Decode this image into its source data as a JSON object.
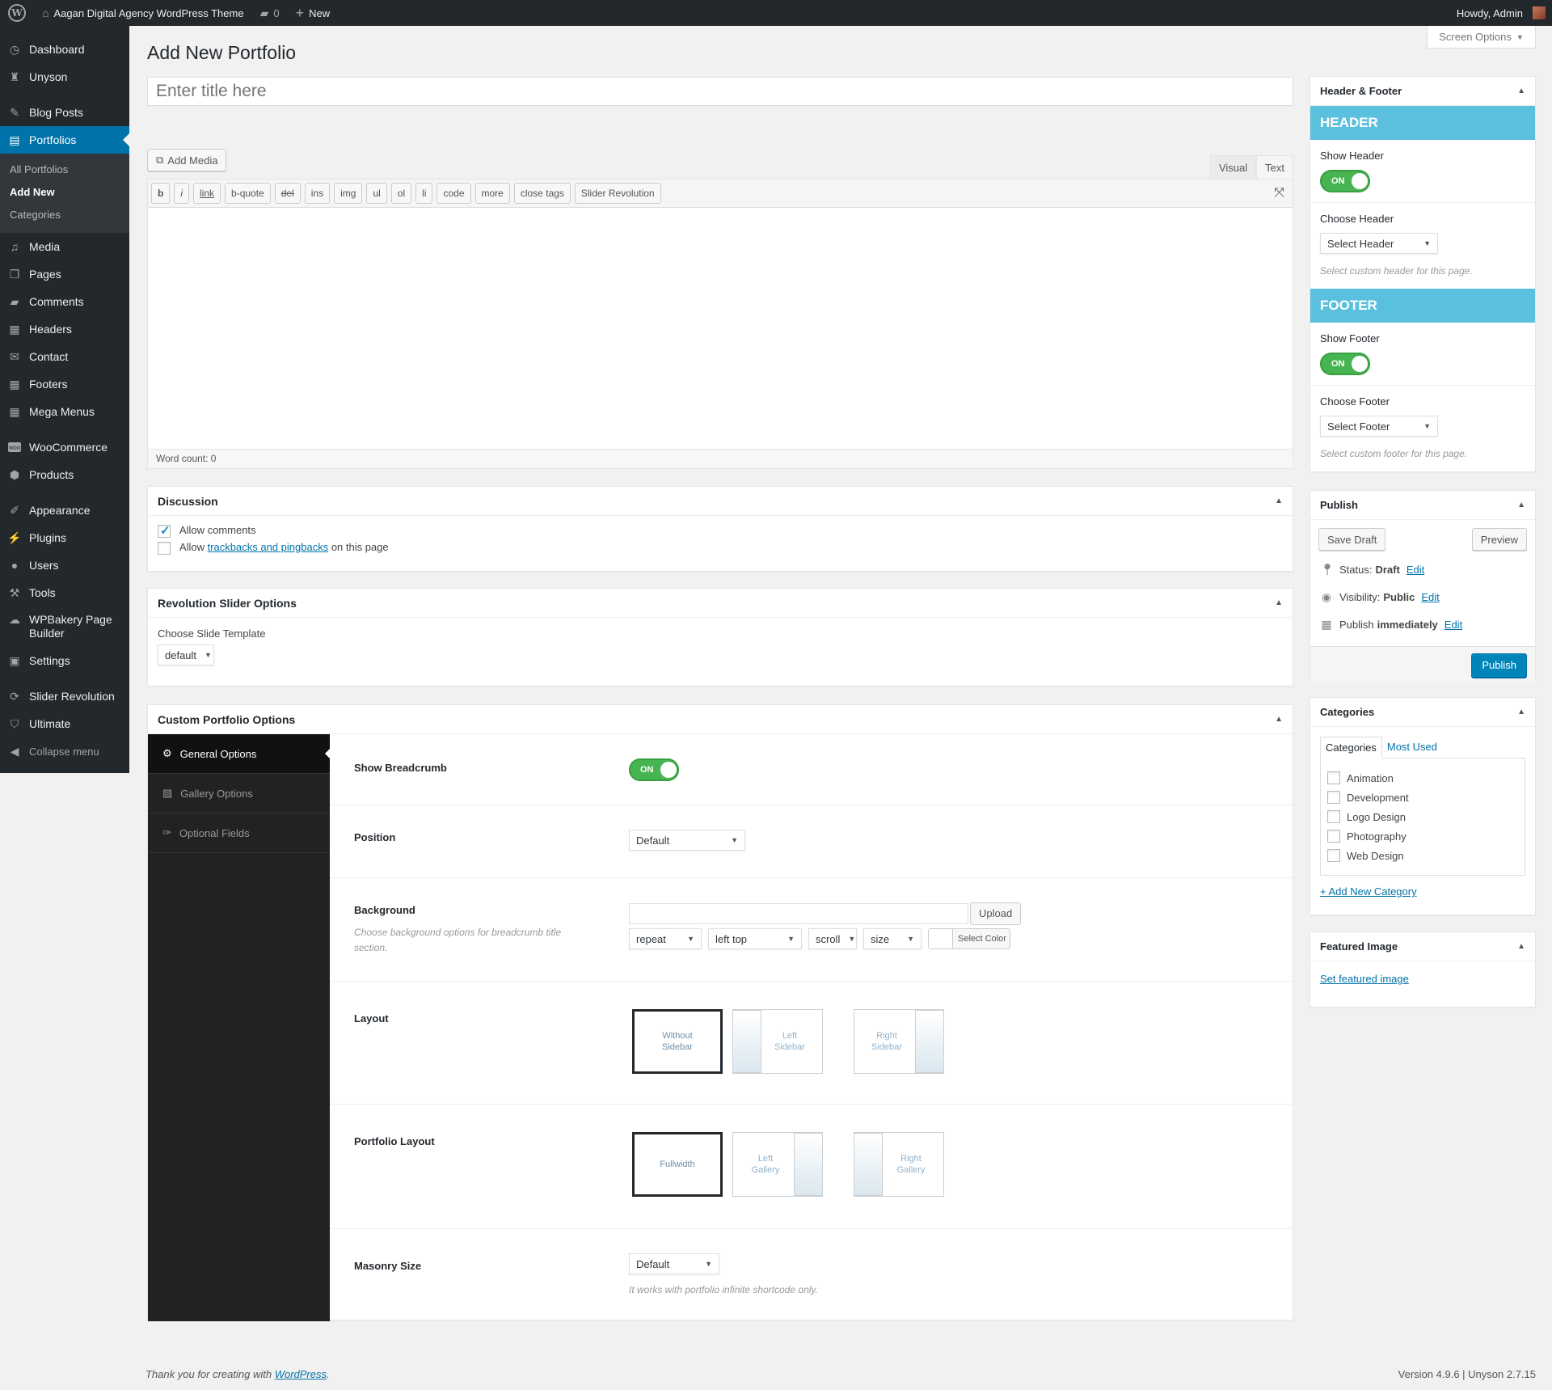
{
  "adminbar": {
    "site_name": "Aagan Digital Agency WordPress Theme",
    "comments_count": "0",
    "new_label": "New",
    "howdy": "Howdy, Admin"
  },
  "sidebar": {
    "dashboard": "Dashboard",
    "unyson": "Unyson",
    "blog_posts": "Blog Posts",
    "portfolios": "Portfolios",
    "sub_all": "All Portfolios",
    "sub_add": "Add New",
    "sub_categories": "Categories",
    "media": "Media",
    "pages": "Pages",
    "comments": "Comments",
    "headers": "Headers",
    "contact": "Contact",
    "footers": "Footers",
    "mega_menus": "Mega Menus",
    "woocommerce": "WooCommerce",
    "products": "Products",
    "appearance": "Appearance",
    "plugins": "Plugins",
    "users": "Users",
    "tools": "Tools",
    "wpbakery_1": "WPBakery Page",
    "wpbakery_2": "Builder",
    "settings": "Settings",
    "slider_revolution": "Slider Revolution",
    "ultimate": "Ultimate",
    "collapse": "Collapse menu"
  },
  "screen_options": "Screen Options",
  "page_title": "Add New Portfolio",
  "title_placeholder": "Enter title here",
  "editor": {
    "add_media": "Add Media",
    "tab_visual": "Visual",
    "tab_text": "Text",
    "qt": [
      "b",
      "i",
      "link",
      "b-quote",
      "del",
      "ins",
      "img",
      "ul",
      "ol",
      "li",
      "code",
      "more",
      "close tags",
      "Slider Revolution"
    ],
    "word_count": "Word count: 0"
  },
  "discussion": {
    "title": "Discussion",
    "allow_comments": "Allow comments",
    "allow_prefix": "Allow",
    "trackbacks_link": "trackbacks and pingbacks",
    "allow_suffix": "on this page"
  },
  "rev_slider": {
    "title": "Revolution Slider Options",
    "choose_label": "Choose Slide Template",
    "template_value": "default"
  },
  "custom_portfolio": {
    "title": "Custom Portfolio Options",
    "nav": [
      "General Options",
      "Gallery Options",
      "Optional Fields"
    ],
    "show_breadcrumb": "Show Breadcrumb",
    "switch_on": "ON",
    "position_label": "Position",
    "position_value": "Default",
    "background_label": "Background",
    "background_desc": "Choose background options for breadcrumb title section.",
    "upload": "Upload",
    "bg_repeat": "repeat",
    "bg_position": "left top",
    "bg_attachment": "scroll",
    "bg_size": "size",
    "select_color": "Select Color",
    "layout_label": "Layout",
    "layout_opts": [
      "Without Sidebar",
      "Left Sidebar",
      "Right Sidebar"
    ],
    "portfolio_layout_label": "Portfolio Layout",
    "portfolio_layout_opts": [
      "Fullwidth",
      "Left Gallery",
      "Right Gallery"
    ],
    "masonry_label": "Masonry Size",
    "masonry_value": "Default",
    "masonry_desc": "It works with portfolio infinite shortcode only."
  },
  "header_footer": {
    "title": "Header & Footer",
    "header_banner": "HEADER",
    "show_header": "Show Header",
    "choose_header": "Choose Header",
    "select_header": "Select Header",
    "header_desc": "Select custom header for this page.",
    "footer_banner": "FOOTER",
    "show_footer": "Show Footer",
    "choose_footer": "Choose Footer",
    "select_footer": "Select Footer",
    "footer_desc": "Select custom footer for this page."
  },
  "publish": {
    "title": "Publish",
    "save_draft": "Save Draft",
    "preview": "Preview",
    "status_label": "Status:",
    "status_value": "Draft",
    "visibility_label": "Visibility:",
    "visibility_value": "Public",
    "publish_label": "Publish",
    "publish_value": "immediately",
    "edit": "Edit",
    "publish_btn": "Publish"
  },
  "categories": {
    "title": "Categories",
    "tab_all": "Categories",
    "tab_most": "Most Used",
    "items": [
      "Animation",
      "Development",
      "Logo Design",
      "Photography",
      "Web Design"
    ],
    "add_new": "+ Add New Category"
  },
  "featured": {
    "title": "Featured Image",
    "set_link": "Set featured image"
  },
  "footer": {
    "thanks_prefix": "Thank you for creating with",
    "wordpress": "WordPress",
    "thanks_suffix": ".",
    "version": "Version 4.9.6 | Unyson 2.7.15"
  },
  "colors": {
    "accent": "#0073aa",
    "banner": "#5bc0de",
    "switch_on": "#46b450",
    "sidebar_bg": "#23282d"
  }
}
